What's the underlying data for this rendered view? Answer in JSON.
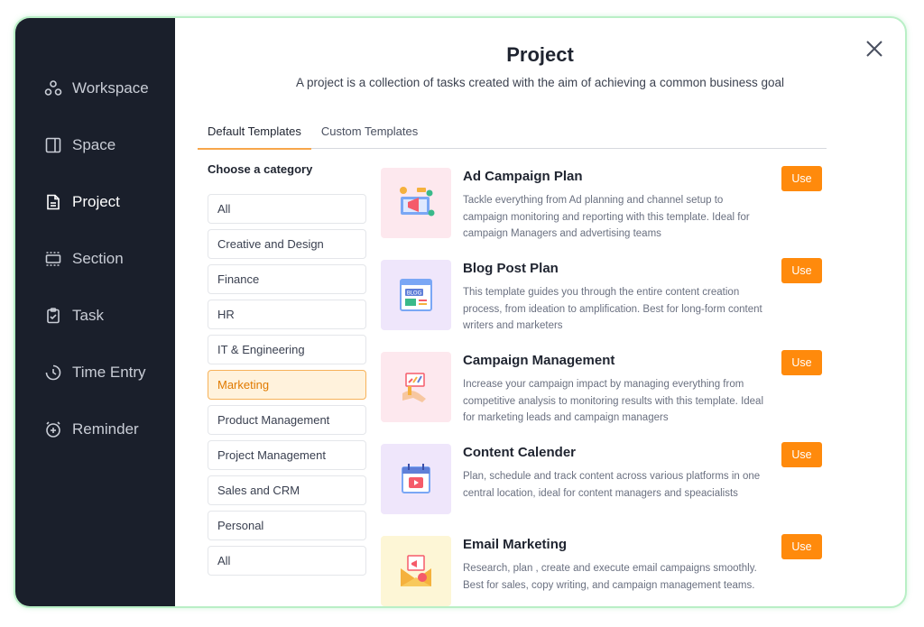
{
  "sidebar": {
    "items": [
      {
        "label": "Workspace",
        "icon": "workspace-icon"
      },
      {
        "label": "Space",
        "icon": "space-icon"
      },
      {
        "label": "Project",
        "icon": "project-icon"
      },
      {
        "label": "Section",
        "icon": "section-icon"
      },
      {
        "label": "Task",
        "icon": "task-icon"
      },
      {
        "label": "Time Entry",
        "icon": "time-entry-icon"
      },
      {
        "label": "Reminder",
        "icon": "reminder-icon"
      }
    ],
    "active": "Project"
  },
  "modal": {
    "title": "Project",
    "subtitle": "A project is a collection of tasks created with the aim of achieving a common business goal"
  },
  "tabs": [
    {
      "label": "Default Templates"
    },
    {
      "label": "Custom Templates"
    }
  ],
  "categories": {
    "title": "Choose a category",
    "items": [
      "All",
      "Creative and Design",
      "Finance",
      "HR",
      "IT & Engineering",
      "Marketing",
      "Product Management",
      "Project Management",
      "Sales and CRM",
      "Personal",
      "All"
    ],
    "selected": "Marketing"
  },
  "templates": [
    {
      "title": "Ad Campaign Plan",
      "desc": "Tackle everything from Ad planning and channel setup to campaign monitoring and reporting with this template. Ideal for campaign Managers and advertising teams",
      "button": "Use",
      "thumb_color": "#fde8ee"
    },
    {
      "title": "Blog Post Plan",
      "desc": "This template guides you through the entire content creation process, from ideation to amplification. Best for long-form content writers and marketers",
      "button": "Use",
      "thumb_color": "#efe6fb"
    },
    {
      "title": "Campaign Management",
      "desc": "Increase your campaign impact by managing everything from competitive analysis to monitoring results with this template. Ideal for marketing leads and campaign managers",
      "button": "Use",
      "thumb_color": "#fde8ee"
    },
    {
      "title": "Content Calender",
      "desc": "Plan, schedule and track content across various platforms in one central location, ideal for content managers and speacialists",
      "button": "Use",
      "thumb_color": "#efe6fb"
    },
    {
      "title": "Email Marketing",
      "desc": "Research, plan , create and execute email campaigns smoothly. Best for sales, copy writing, and campaign management teams.",
      "button": "Use",
      "thumb_color": "#fdf6d6"
    }
  ],
  "colors": {
    "accent": "#ff8a0c",
    "sidebar_bg": "#1a1f2b",
    "selected_bg": "#fff2dc"
  }
}
